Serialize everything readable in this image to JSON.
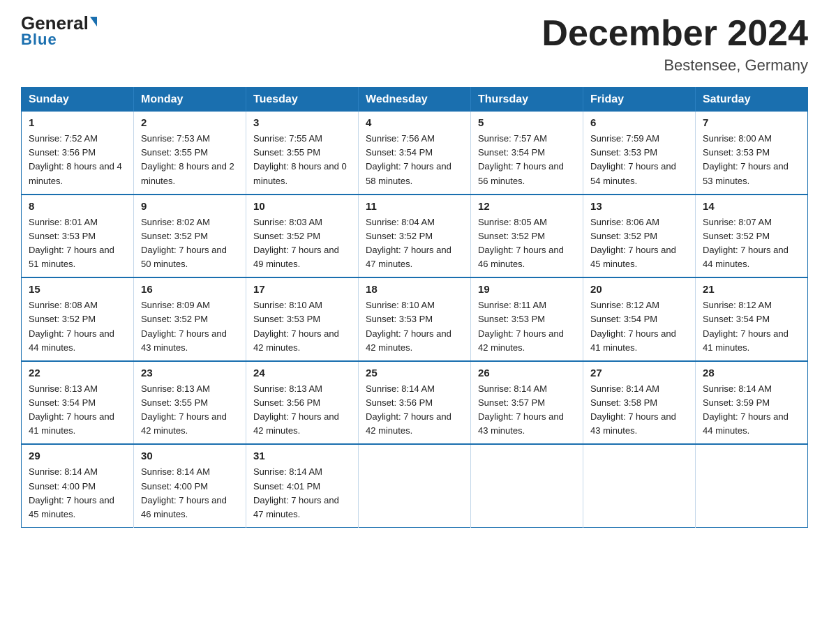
{
  "logo": {
    "general": "General",
    "blue": "Blue",
    "triangle": "▶"
  },
  "header": {
    "month_year": "December 2024",
    "location": "Bestensee, Germany"
  },
  "weekdays": [
    "Sunday",
    "Monday",
    "Tuesday",
    "Wednesday",
    "Thursday",
    "Friday",
    "Saturday"
  ],
  "weeks": [
    [
      {
        "day": "1",
        "sunrise": "Sunrise: 7:52 AM",
        "sunset": "Sunset: 3:56 PM",
        "daylight": "Daylight: 8 hours and 4 minutes."
      },
      {
        "day": "2",
        "sunrise": "Sunrise: 7:53 AM",
        "sunset": "Sunset: 3:55 PM",
        "daylight": "Daylight: 8 hours and 2 minutes."
      },
      {
        "day": "3",
        "sunrise": "Sunrise: 7:55 AM",
        "sunset": "Sunset: 3:55 PM",
        "daylight": "Daylight: 8 hours and 0 minutes."
      },
      {
        "day": "4",
        "sunrise": "Sunrise: 7:56 AM",
        "sunset": "Sunset: 3:54 PM",
        "daylight": "Daylight: 7 hours and 58 minutes."
      },
      {
        "day": "5",
        "sunrise": "Sunrise: 7:57 AM",
        "sunset": "Sunset: 3:54 PM",
        "daylight": "Daylight: 7 hours and 56 minutes."
      },
      {
        "day": "6",
        "sunrise": "Sunrise: 7:59 AM",
        "sunset": "Sunset: 3:53 PM",
        "daylight": "Daylight: 7 hours and 54 minutes."
      },
      {
        "day": "7",
        "sunrise": "Sunrise: 8:00 AM",
        "sunset": "Sunset: 3:53 PM",
        "daylight": "Daylight: 7 hours and 53 minutes."
      }
    ],
    [
      {
        "day": "8",
        "sunrise": "Sunrise: 8:01 AM",
        "sunset": "Sunset: 3:53 PM",
        "daylight": "Daylight: 7 hours and 51 minutes."
      },
      {
        "day": "9",
        "sunrise": "Sunrise: 8:02 AM",
        "sunset": "Sunset: 3:52 PM",
        "daylight": "Daylight: 7 hours and 50 minutes."
      },
      {
        "day": "10",
        "sunrise": "Sunrise: 8:03 AM",
        "sunset": "Sunset: 3:52 PM",
        "daylight": "Daylight: 7 hours and 49 minutes."
      },
      {
        "day": "11",
        "sunrise": "Sunrise: 8:04 AM",
        "sunset": "Sunset: 3:52 PM",
        "daylight": "Daylight: 7 hours and 47 minutes."
      },
      {
        "day": "12",
        "sunrise": "Sunrise: 8:05 AM",
        "sunset": "Sunset: 3:52 PM",
        "daylight": "Daylight: 7 hours and 46 minutes."
      },
      {
        "day": "13",
        "sunrise": "Sunrise: 8:06 AM",
        "sunset": "Sunset: 3:52 PM",
        "daylight": "Daylight: 7 hours and 45 minutes."
      },
      {
        "day": "14",
        "sunrise": "Sunrise: 8:07 AM",
        "sunset": "Sunset: 3:52 PM",
        "daylight": "Daylight: 7 hours and 44 minutes."
      }
    ],
    [
      {
        "day": "15",
        "sunrise": "Sunrise: 8:08 AM",
        "sunset": "Sunset: 3:52 PM",
        "daylight": "Daylight: 7 hours and 44 minutes."
      },
      {
        "day": "16",
        "sunrise": "Sunrise: 8:09 AM",
        "sunset": "Sunset: 3:52 PM",
        "daylight": "Daylight: 7 hours and 43 minutes."
      },
      {
        "day": "17",
        "sunrise": "Sunrise: 8:10 AM",
        "sunset": "Sunset: 3:53 PM",
        "daylight": "Daylight: 7 hours and 42 minutes."
      },
      {
        "day": "18",
        "sunrise": "Sunrise: 8:10 AM",
        "sunset": "Sunset: 3:53 PM",
        "daylight": "Daylight: 7 hours and 42 minutes."
      },
      {
        "day": "19",
        "sunrise": "Sunrise: 8:11 AM",
        "sunset": "Sunset: 3:53 PM",
        "daylight": "Daylight: 7 hours and 42 minutes."
      },
      {
        "day": "20",
        "sunrise": "Sunrise: 8:12 AM",
        "sunset": "Sunset: 3:54 PM",
        "daylight": "Daylight: 7 hours and 41 minutes."
      },
      {
        "day": "21",
        "sunrise": "Sunrise: 8:12 AM",
        "sunset": "Sunset: 3:54 PM",
        "daylight": "Daylight: 7 hours and 41 minutes."
      }
    ],
    [
      {
        "day": "22",
        "sunrise": "Sunrise: 8:13 AM",
        "sunset": "Sunset: 3:54 PM",
        "daylight": "Daylight: 7 hours and 41 minutes."
      },
      {
        "day": "23",
        "sunrise": "Sunrise: 8:13 AM",
        "sunset": "Sunset: 3:55 PM",
        "daylight": "Daylight: 7 hours and 42 minutes."
      },
      {
        "day": "24",
        "sunrise": "Sunrise: 8:13 AM",
        "sunset": "Sunset: 3:56 PM",
        "daylight": "Daylight: 7 hours and 42 minutes."
      },
      {
        "day": "25",
        "sunrise": "Sunrise: 8:14 AM",
        "sunset": "Sunset: 3:56 PM",
        "daylight": "Daylight: 7 hours and 42 minutes."
      },
      {
        "day": "26",
        "sunrise": "Sunrise: 8:14 AM",
        "sunset": "Sunset: 3:57 PM",
        "daylight": "Daylight: 7 hours and 43 minutes."
      },
      {
        "day": "27",
        "sunrise": "Sunrise: 8:14 AM",
        "sunset": "Sunset: 3:58 PM",
        "daylight": "Daylight: 7 hours and 43 minutes."
      },
      {
        "day": "28",
        "sunrise": "Sunrise: 8:14 AM",
        "sunset": "Sunset: 3:59 PM",
        "daylight": "Daylight: 7 hours and 44 minutes."
      }
    ],
    [
      {
        "day": "29",
        "sunrise": "Sunrise: 8:14 AM",
        "sunset": "Sunset: 4:00 PM",
        "daylight": "Daylight: 7 hours and 45 minutes."
      },
      {
        "day": "30",
        "sunrise": "Sunrise: 8:14 AM",
        "sunset": "Sunset: 4:00 PM",
        "daylight": "Daylight: 7 hours and 46 minutes."
      },
      {
        "day": "31",
        "sunrise": "Sunrise: 8:14 AM",
        "sunset": "Sunset: 4:01 PM",
        "daylight": "Daylight: 7 hours and 47 minutes."
      },
      null,
      null,
      null,
      null
    ]
  ]
}
